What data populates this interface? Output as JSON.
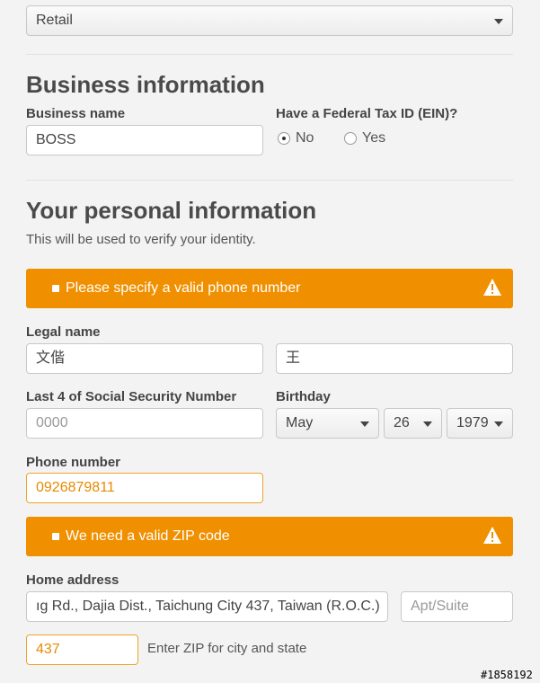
{
  "business_type": {
    "selected": "Retail"
  },
  "business": {
    "heading": "Business information",
    "name_label": "Business name",
    "name_value": "BOSS",
    "ein_label": "Have a Federal Tax ID (EIN)?",
    "ein_options": [
      {
        "label": "No",
        "selected": true
      },
      {
        "label": "Yes",
        "selected": false
      }
    ]
  },
  "personal": {
    "heading": "Your personal information",
    "subtitle": "This will be used to verify your identity.",
    "phone_alert": "Please specify a valid phone number",
    "legal_name_label": "Legal name",
    "first_name": "文偕",
    "last_name": "王",
    "ssn_label": "Last 4 of Social Security Number",
    "ssn_placeholder": "0000",
    "birthday_label": "Birthday",
    "birth_month": "May",
    "birth_day": "26",
    "birth_year": "1979",
    "phone_label": "Phone number",
    "phone_value": "0926879811",
    "zip_alert": "We need a valid ZIP code",
    "address_label": "Home address",
    "address_value": "ıg Rd., Dajia Dist., Taichung City 437, Taiwan (R.O.C.)",
    "apt_placeholder": "Apt/Suite",
    "zip_value": "437",
    "zip_hint": "Enter ZIP for city and state"
  },
  "watermark": "#1858192",
  "colors": {
    "alert": "#f09000",
    "error_border": "#f0a22a",
    "error_text": "#e78a00"
  }
}
